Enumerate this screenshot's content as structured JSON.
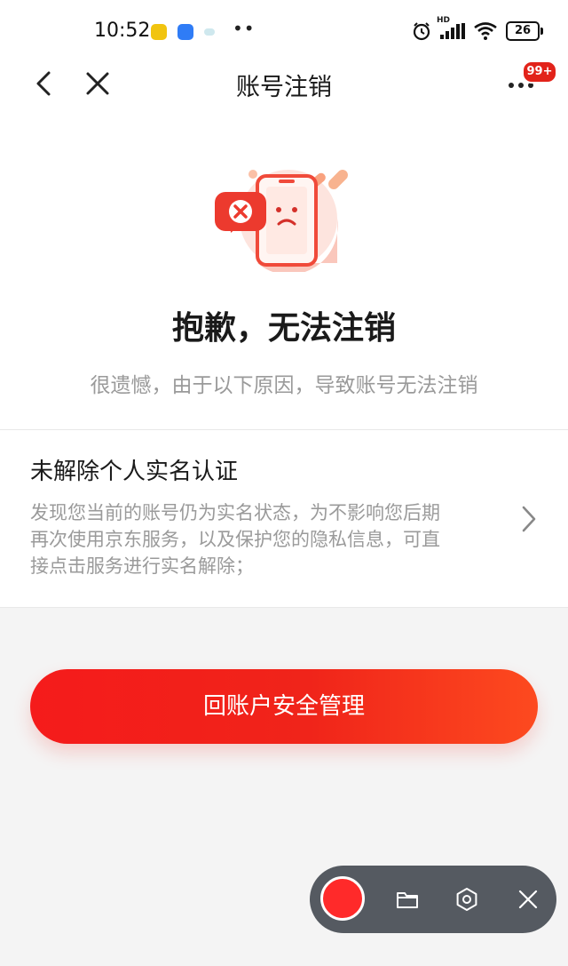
{
  "status_bar": {
    "time": "10:52",
    "network_label": "HD",
    "battery": "26"
  },
  "nav": {
    "title": "账号注销",
    "message_badge": "99+"
  },
  "result": {
    "title": "抱歉，无法注销",
    "subtitle": "很遗憾，由于以下原因，导致账号无法注销"
  },
  "reason": {
    "title": "未解除个人实名认证",
    "description": "发现您当前的账号仍为实名状态，为不影响您后期再次使用京东服务，以及保护您的隐私信息，可直接点击服务进行实名解除；"
  },
  "primary_button": {
    "label": "回账户安全管理"
  },
  "colors": {
    "accent": "#f0241a",
    "background": "#f4f4f4"
  }
}
